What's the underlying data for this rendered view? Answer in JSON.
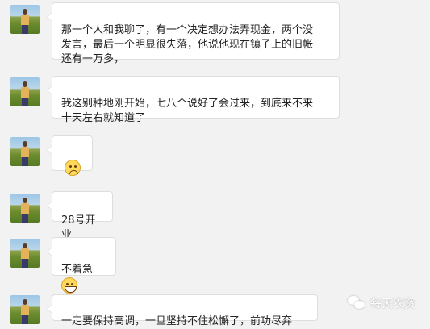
{
  "messages": [
    {
      "text": "那一个人和我聊了，有一个决定想办法弄现金，两个没\n发言，最后一个明显很失落，他说他现在镇子上的旧帐\n还有一万多，"
    },
    {
      "text": "我这别种地刚开始，七八个说好了会过来，到底来不来\n十天左右就知道了"
    },
    {
      "emoji": "sad-face-icon"
    },
    {
      "text": "28号开业"
    },
    {
      "text": "不着急",
      "emoji": "grinning-face-icon"
    },
    {
      "text": "一定要保持高调，一旦坚持不住松懈了，前功尽弃"
    }
  ],
  "watermark": {
    "icon": "wechat-icon",
    "text": "每天农资"
  },
  "colors": {
    "background": "#f2f2f2",
    "bubble": "#ffffff",
    "bubble_border": "#dedede"
  }
}
